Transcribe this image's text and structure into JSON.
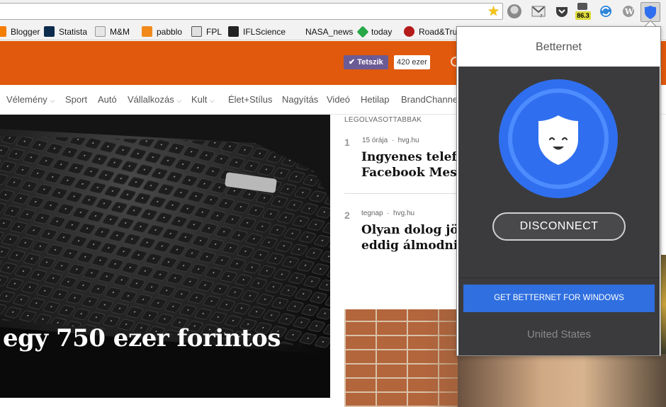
{
  "browser": {
    "extensions": [
      {
        "name": "profile-face-icon"
      },
      {
        "name": "gmail-notifier-icon"
      },
      {
        "name": "pocket-icon"
      },
      {
        "name": "badge-extension-icon",
        "badge": "86.3"
      },
      {
        "name": "sync-icon"
      },
      {
        "name": "wordpress-icon"
      },
      {
        "name": "betternet-icon"
      }
    ]
  },
  "bookmarks": [
    {
      "label": "Blogger",
      "icon": "blogger-icon",
      "color": "#f57d00"
    },
    {
      "label": "Statista",
      "icon": "statista-icon",
      "color": "#0c2b4d"
    },
    {
      "label": "M&M",
      "icon": "mm-icon",
      "color": "#d9d9d9"
    },
    {
      "label": "pabblo",
      "icon": "pabblo-icon",
      "color": "#f08a1c"
    },
    {
      "label": "FPL",
      "icon": "fpl-icon",
      "color": "#555555"
    },
    {
      "label": "IFLScience",
      "icon": "rocket-icon",
      "color": "#222222"
    },
    {
      "label": "NASA_news",
      "icon": "",
      "color": ""
    },
    {
      "label": "today",
      "icon": "today-icon",
      "color": "#27a745"
    },
    {
      "label": "Road&Tru",
      "icon": "roadtrip-icon",
      "color": "#b51b1b"
    }
  ],
  "header": {
    "like_label": "✔ Tetszik",
    "like_count": "420 ezer"
  },
  "nav": [
    {
      "label": "Vélemény",
      "dropdown": true
    },
    {
      "label": "Sport",
      "dropdown": false
    },
    {
      "label": "Autó",
      "dropdown": false
    },
    {
      "label": "Vállalkozás",
      "dropdown": true
    },
    {
      "label": "Kult",
      "dropdown": true
    },
    {
      "label": "Élet+Stílus",
      "dropdown": false
    },
    {
      "label": "Nagyítás",
      "dropdown": false
    },
    {
      "label": "Videó",
      "dropdown": false
    },
    {
      "label": "Hetilap",
      "dropdown": false
    },
    {
      "label": "BrandChannel",
      "dropdown": false
    }
  ],
  "hero": {
    "title": "egy 750 ezer forintos"
  },
  "most_read": {
    "heading": "LEGOLVASOTTABBAK",
    "items": [
      {
        "rank": "1",
        "time": "15 órája",
        "source": "hvg.hu",
        "title_line1": "Ingyenes telefon",
        "title_line2": "Facebook Messe"
      },
      {
        "rank": "2",
        "time": "tegnap",
        "source": "hvg.hu",
        "title_line1": "Olyan dolog jöhe",
        "title_line2": "eddig álmodni se"
      }
    ]
  },
  "popup": {
    "title": "Betternet",
    "disconnect_label": "DISCONNECT",
    "get_windows_label": "GET BETTERNET FOR WINDOWS",
    "location": "United States",
    "colors": {
      "accent": "#2f6fe0",
      "dark_bg": "#3b3b3d"
    }
  }
}
